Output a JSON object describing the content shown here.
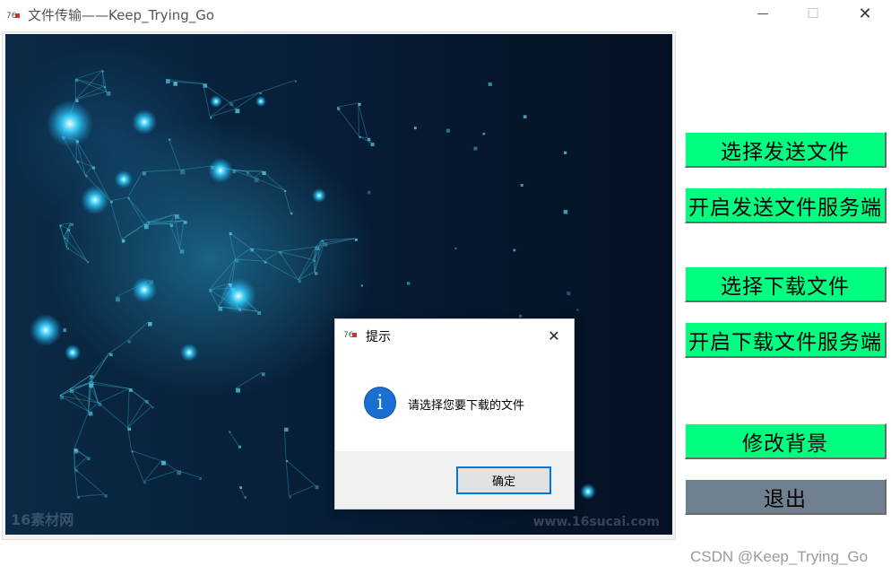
{
  "window": {
    "title": "文件传输——Keep_Trying_Go",
    "controls": {
      "minimize": "—",
      "maximize": "☐",
      "close": "✕"
    }
  },
  "canvas": {
    "background_desc_colors": {
      "deep": "#06162b",
      "glow": "#2fd6ff"
    },
    "watermark_left": "16素材网",
    "watermark_right": "www.16sucai.com"
  },
  "buttons": {
    "select_send": "选择发送文件",
    "start_send_server": "开启发送文件服务端",
    "select_download": "选择下载文件",
    "start_download_server": "开启下载文件服务端",
    "change_background": "修改背景",
    "exit": "退出"
  },
  "dialog": {
    "title": "提示",
    "message": "请选择您要下载的文件",
    "ok": "确定",
    "close": "✕",
    "icon_glyph": "i"
  },
  "colors": {
    "button_green": "#00ff80",
    "button_gray": "#708090",
    "accent": "#0078d7"
  },
  "footer_watermark": "CSDN @Keep_Trying_Go"
}
